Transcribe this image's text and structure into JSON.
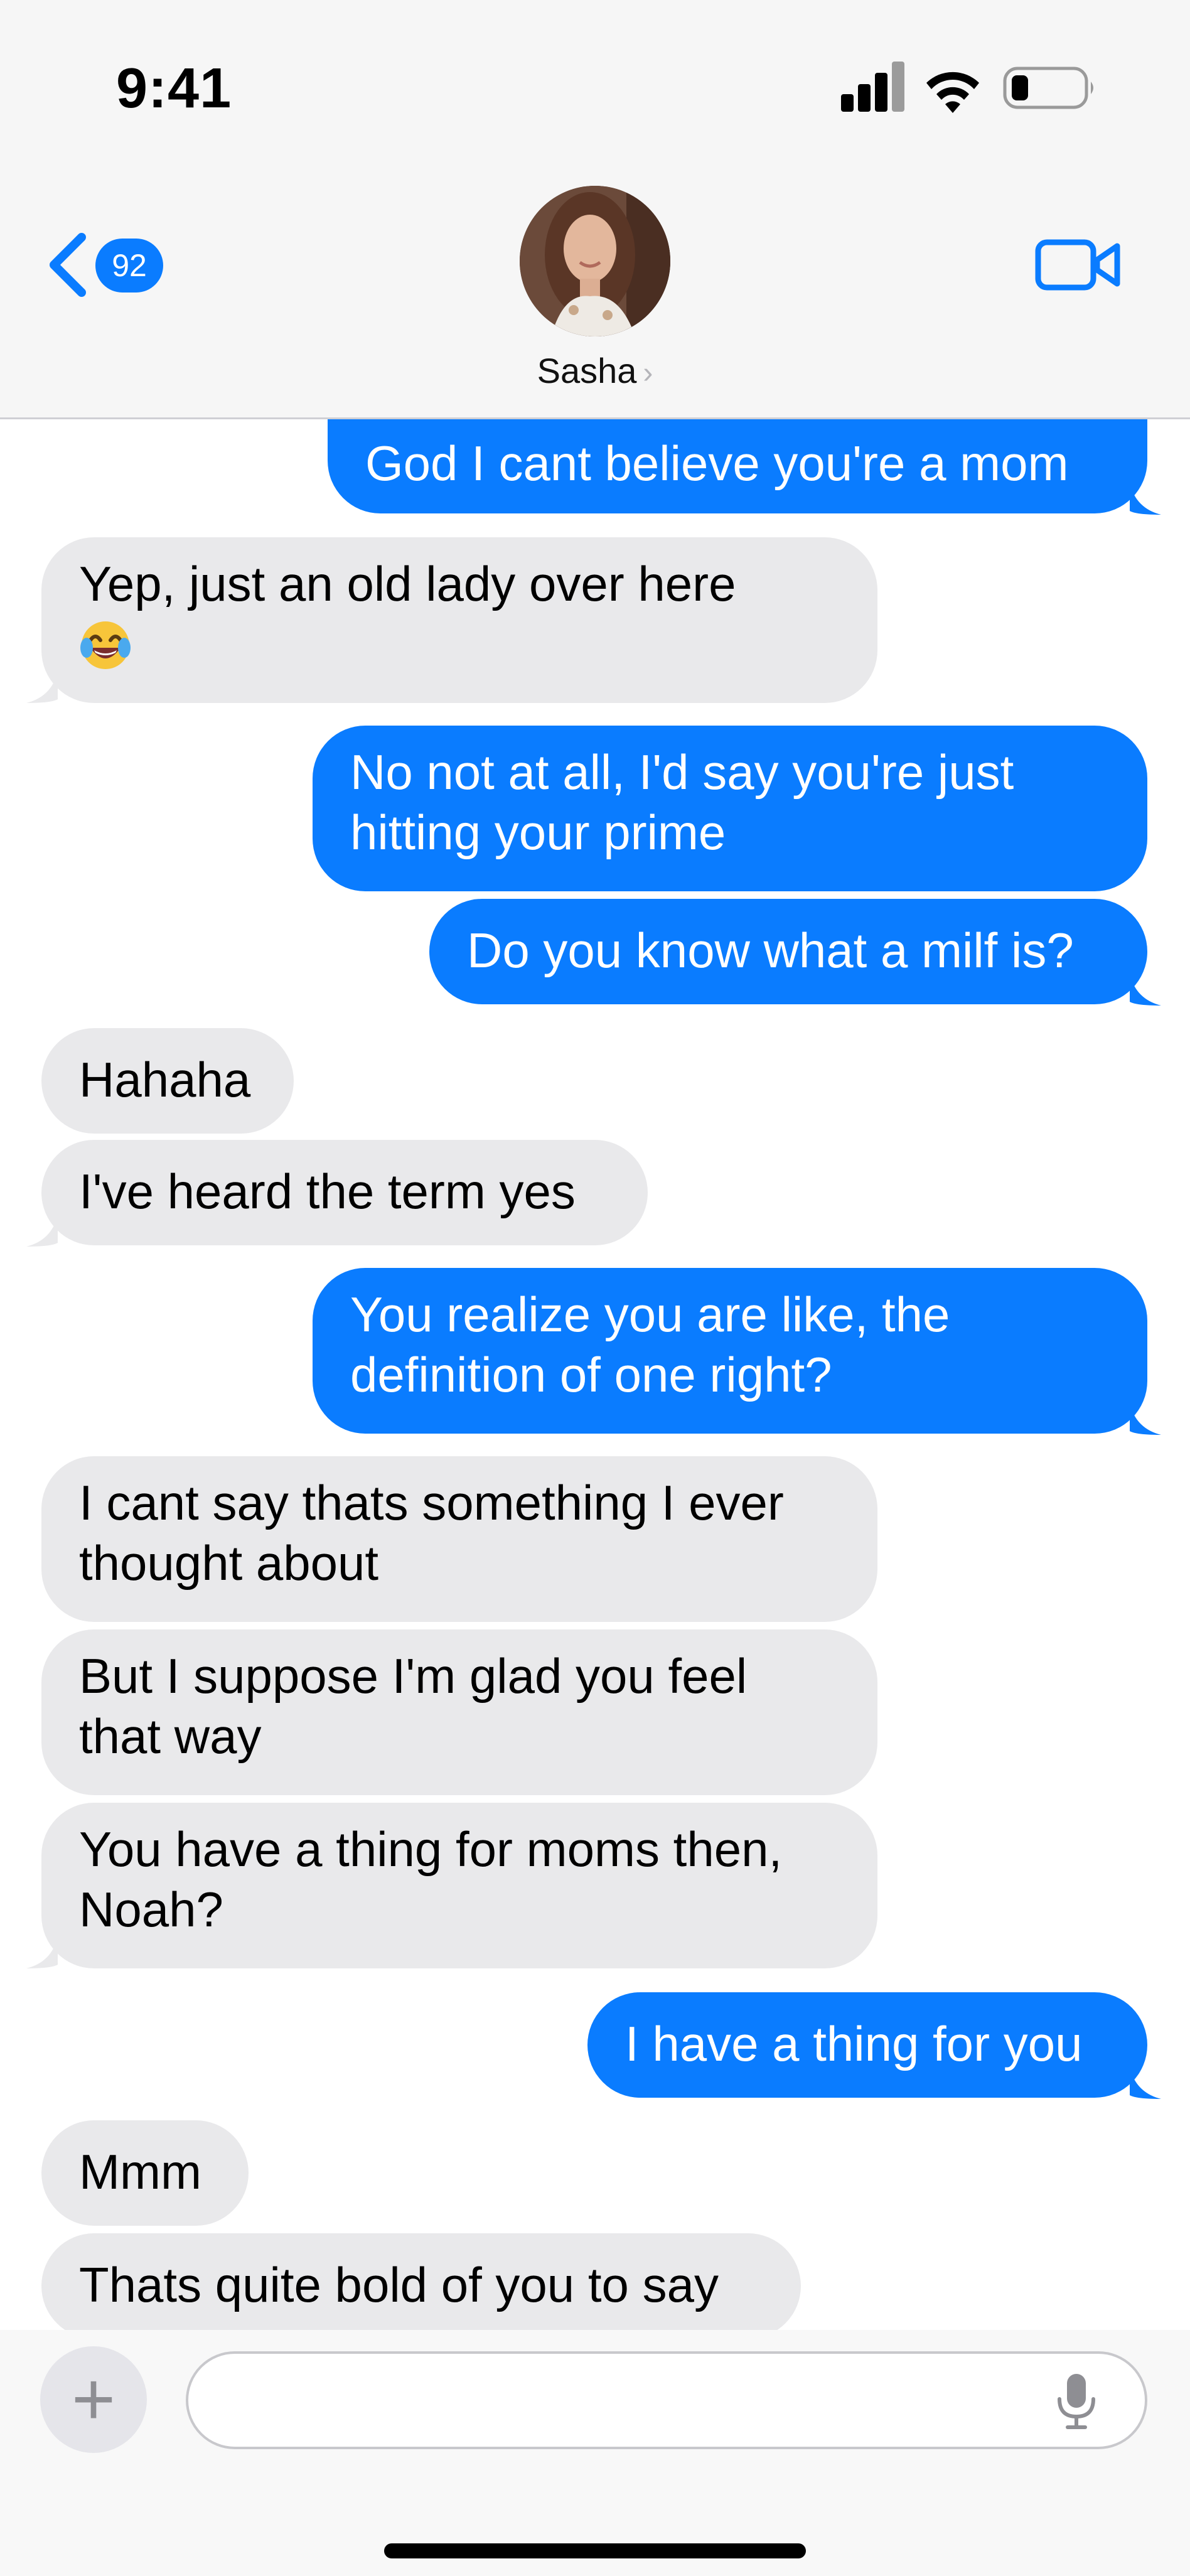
{
  "status_bar": {
    "time": "9:41"
  },
  "header": {
    "back_badge_count": "92",
    "contact_name": "Sasha",
    "icons": {
      "back": "chevron-left-icon",
      "video": "video-camera-icon"
    }
  },
  "messages": [
    {
      "sender": "me",
      "text": "God I cant believe you're a mom"
    },
    {
      "sender": "them",
      "text": "Yep, just an old lady over here",
      "emoji": "face-with-tears-of-joy"
    },
    {
      "sender": "me",
      "lines": [
        "No not at all, I'd say you're just",
        "hitting your prime"
      ]
    },
    {
      "sender": "me",
      "text": "Do you know what a milf is?"
    },
    {
      "sender": "them",
      "text": "Hahaha"
    },
    {
      "sender": "them",
      "text": "I've heard the term yes"
    },
    {
      "sender": "me",
      "lines": [
        "You realize you are like, the",
        "definition of one right?"
      ]
    },
    {
      "sender": "them",
      "lines": [
        "I cant say thats something I ever",
        "thought about"
      ]
    },
    {
      "sender": "them",
      "lines": [
        "But I suppose I'm glad you feel",
        "that way"
      ]
    },
    {
      "sender": "them",
      "lines": [
        "You have a thing for moms then,",
        "Noah?"
      ]
    },
    {
      "sender": "me",
      "text": "I have a thing for you"
    },
    {
      "sender": "them",
      "text": "Mmm"
    },
    {
      "sender": "them",
      "text": "Thats quite bold of you to say"
    }
  ],
  "composer": {
    "add_label": "+",
    "input_value": "",
    "icons": {
      "add": "plus-icon",
      "mic": "microphone-icon"
    }
  },
  "colors": {
    "sent_bubble": "#0a7cff",
    "received_bubble": "#e9e9eb",
    "header_bg": "#f6f6f6"
  }
}
